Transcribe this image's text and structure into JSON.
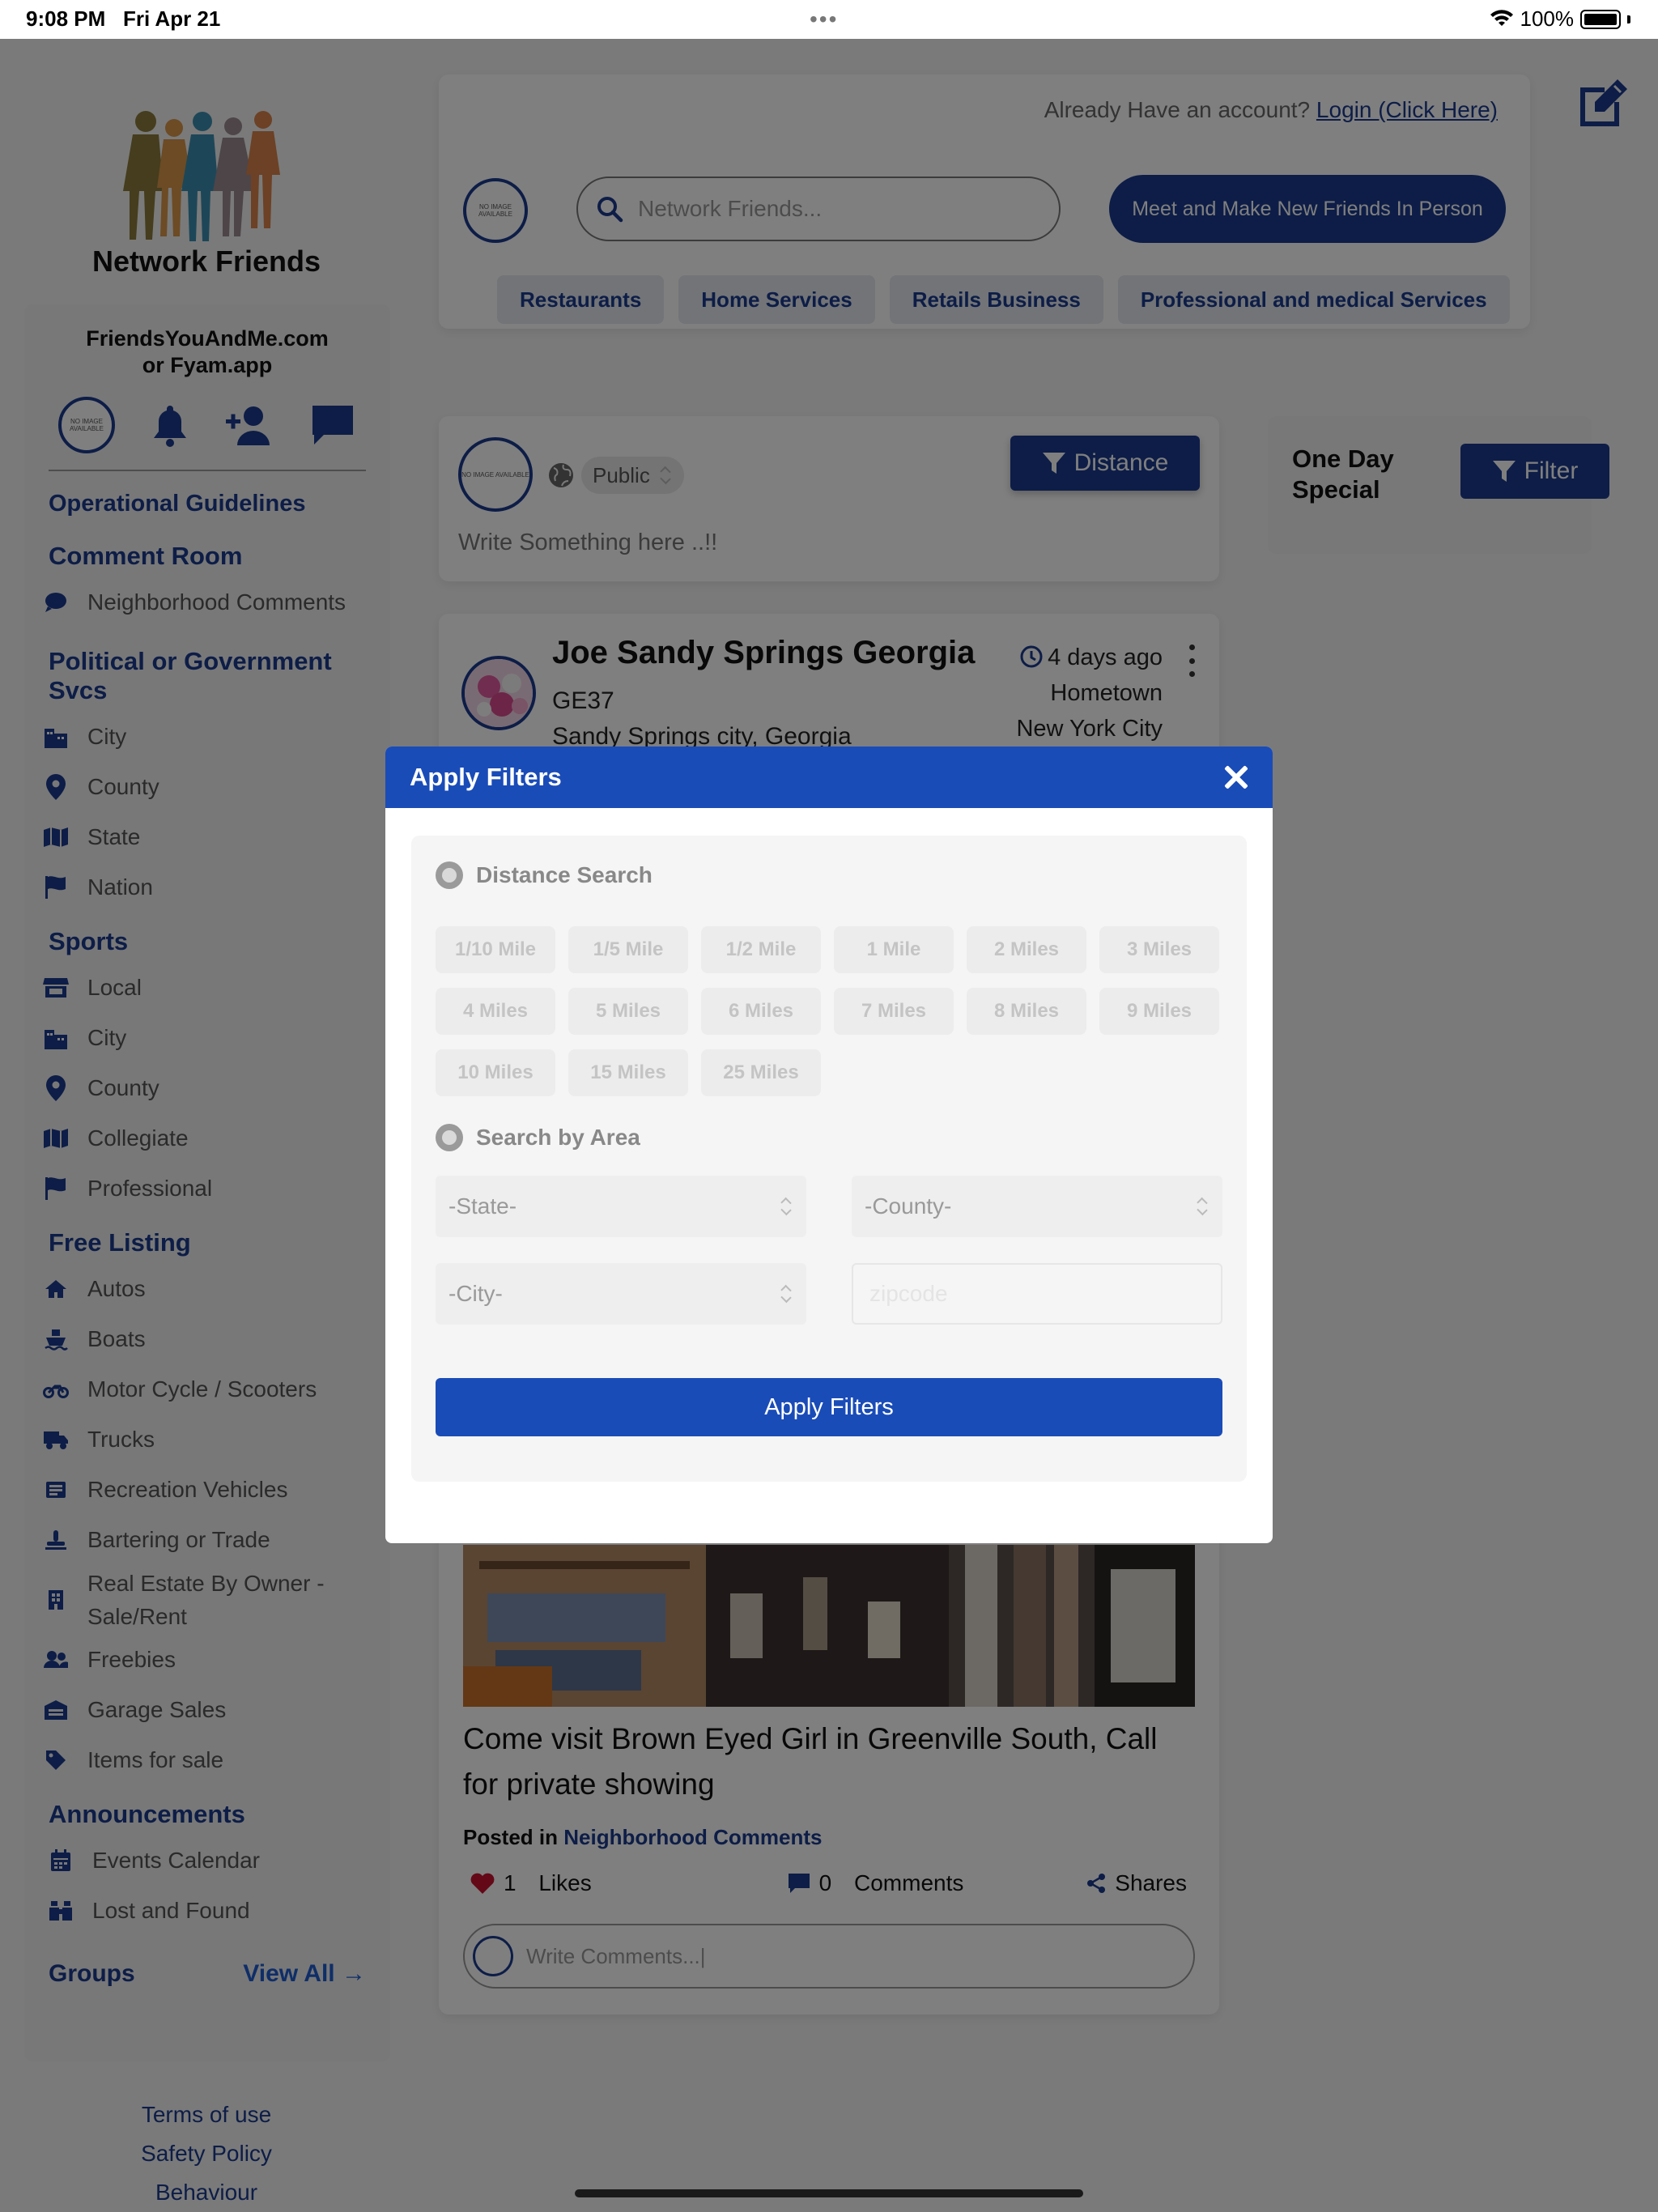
{
  "status": {
    "time": "9:08 PM",
    "date": "Fri Apr 21",
    "battery": "100%"
  },
  "brand": {
    "name": "Network Friends",
    "site": "FriendsYouAndMe.com",
    "site_alt": "or Fyam.app",
    "avatar_text": "NO IMAGE AVAILABLE"
  },
  "header": {
    "already_text": "Already Have an account?",
    "login_link": "Login (Click Here)",
    "search_placeholder": "Network Friends...",
    "meet_button": "Meet and Make New Friends In Person",
    "categories": [
      "Restaurants",
      "Home Services",
      "Retails Business",
      "Professional and medical Services"
    ]
  },
  "sidebar": {
    "operational": "Operational Guidelines",
    "comment_room": {
      "title": "Comment Room",
      "items": [
        {
          "label": "Neighborhood Comments",
          "icon": "comment-icon"
        }
      ]
    },
    "political": {
      "title": "Political or Government Svcs",
      "items": [
        {
          "label": "City",
          "icon": "building-icon"
        },
        {
          "label": "County",
          "icon": "map-pin-icon"
        },
        {
          "label": "State",
          "icon": "map-icon"
        },
        {
          "label": "Nation",
          "icon": "flag-icon"
        }
      ]
    },
    "sports": {
      "title": "Sports",
      "items": [
        {
          "label": "Local",
          "icon": "store-icon"
        },
        {
          "label": "City",
          "icon": "building-icon"
        },
        {
          "label": "County",
          "icon": "map-pin-icon"
        },
        {
          "label": "Collegiate",
          "icon": "map-icon"
        },
        {
          "label": "Professional",
          "icon": "flag-icon"
        }
      ]
    },
    "free_listing": {
      "title": "Free Listing",
      "items": [
        {
          "label": "Autos",
          "icon": "car-icon"
        },
        {
          "label": "Boats",
          "icon": "ship-icon"
        },
        {
          "label": "Motor Cycle / Scooters",
          "icon": "motorcycle-icon"
        },
        {
          "label": "Trucks",
          "icon": "truck-icon"
        },
        {
          "label": "Recreation Vehicles",
          "icon": "rv-icon"
        },
        {
          "label": "Bartering or Trade",
          "icon": "handshake-icon"
        },
        {
          "label": "Real Estate By Owner - Sale/Rent",
          "icon": "building-small-icon"
        },
        {
          "label": "Freebies",
          "icon": "users-icon"
        },
        {
          "label": "Garage Sales",
          "icon": "garage-icon"
        },
        {
          "label": "Items for sale",
          "icon": "tag-icon"
        }
      ]
    },
    "announcements": {
      "title": "Announcements",
      "items": [
        {
          "label": "Events Calendar",
          "icon": "calendar-icon"
        },
        {
          "label": "Lost and Found",
          "icon": "binoculars-icon"
        }
      ]
    },
    "groups": "Groups",
    "view_all": "View All"
  },
  "footer": {
    "links": [
      "Terms of use",
      "Safety Policy",
      "Behaviour"
    ]
  },
  "composer": {
    "privacy": "Public",
    "distance_button": "Distance",
    "placeholder": "Write Something here ..!!"
  },
  "special": {
    "title_line1": "One Day",
    "title_line2": "Special",
    "filter_button": "Filter"
  },
  "post": {
    "author": "Joe Sandy Springs Georgia",
    "code": "GE37",
    "location": "Sandy Springs city, Georgia",
    "time": "4 days ago",
    "hometown_label": "Hometown",
    "hometown": "New York City",
    "title": "Come visit Brown Eyed Girl in Greenville South, Call for private showing",
    "posted_in_label": "Posted in",
    "posted_in": "Neighborhood Comments",
    "likes_count": "1",
    "likes_label": "Likes",
    "comments_count": "0",
    "comments_label": "Comments",
    "shares_label": "Shares",
    "comment_placeholder": "Write Comments...|"
  },
  "modal": {
    "title": "Apply Filters",
    "distance_label": "Distance Search",
    "miles": [
      "1/10 Mile",
      "1/5 Mile",
      "1/2 Mile",
      "1 Mile",
      "2 Miles",
      "3 Miles",
      "4 Miles",
      "5 Miles",
      "6 Miles",
      "7 Miles",
      "8 Miles",
      "9 Miles",
      "10 Miles",
      "15 Miles",
      "25 Miles"
    ],
    "area_label": "Search by Area",
    "state": "-State-",
    "county": "-County-",
    "city": "-City-",
    "zip_placeholder": "zipcode",
    "apply_button": "Apply Filters"
  },
  "colors": {
    "brand_blue": "#1a3a8f",
    "modal_blue": "#1a4cb8"
  }
}
